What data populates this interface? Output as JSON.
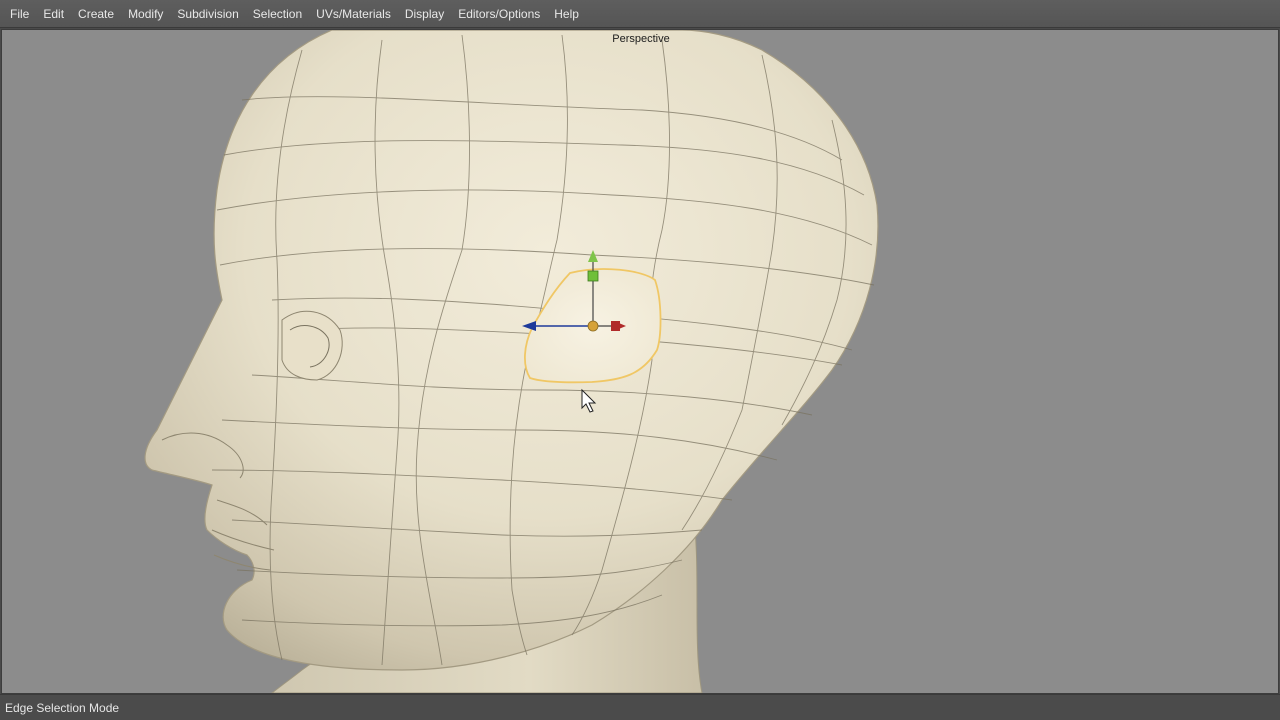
{
  "menubar": {
    "items": [
      "File",
      "Edit",
      "Create",
      "Modify",
      "Subdivision",
      "Selection",
      "UVs/Materials",
      "Display",
      "Editors/Options",
      "Help"
    ]
  },
  "viewport": {
    "label": "Perspective",
    "background_color": "#8c8c8c",
    "mesh_color": "#e8e1cc",
    "selection_color": "#f5d27a"
  },
  "gizmo": {
    "x_axis_color": "#b02a2a",
    "y_axis_color": "#6fbf3a",
    "z_axis_color": "#1e3a9a",
    "center_color": "#d6a238"
  },
  "status": {
    "text": "Edge Selection Mode"
  }
}
